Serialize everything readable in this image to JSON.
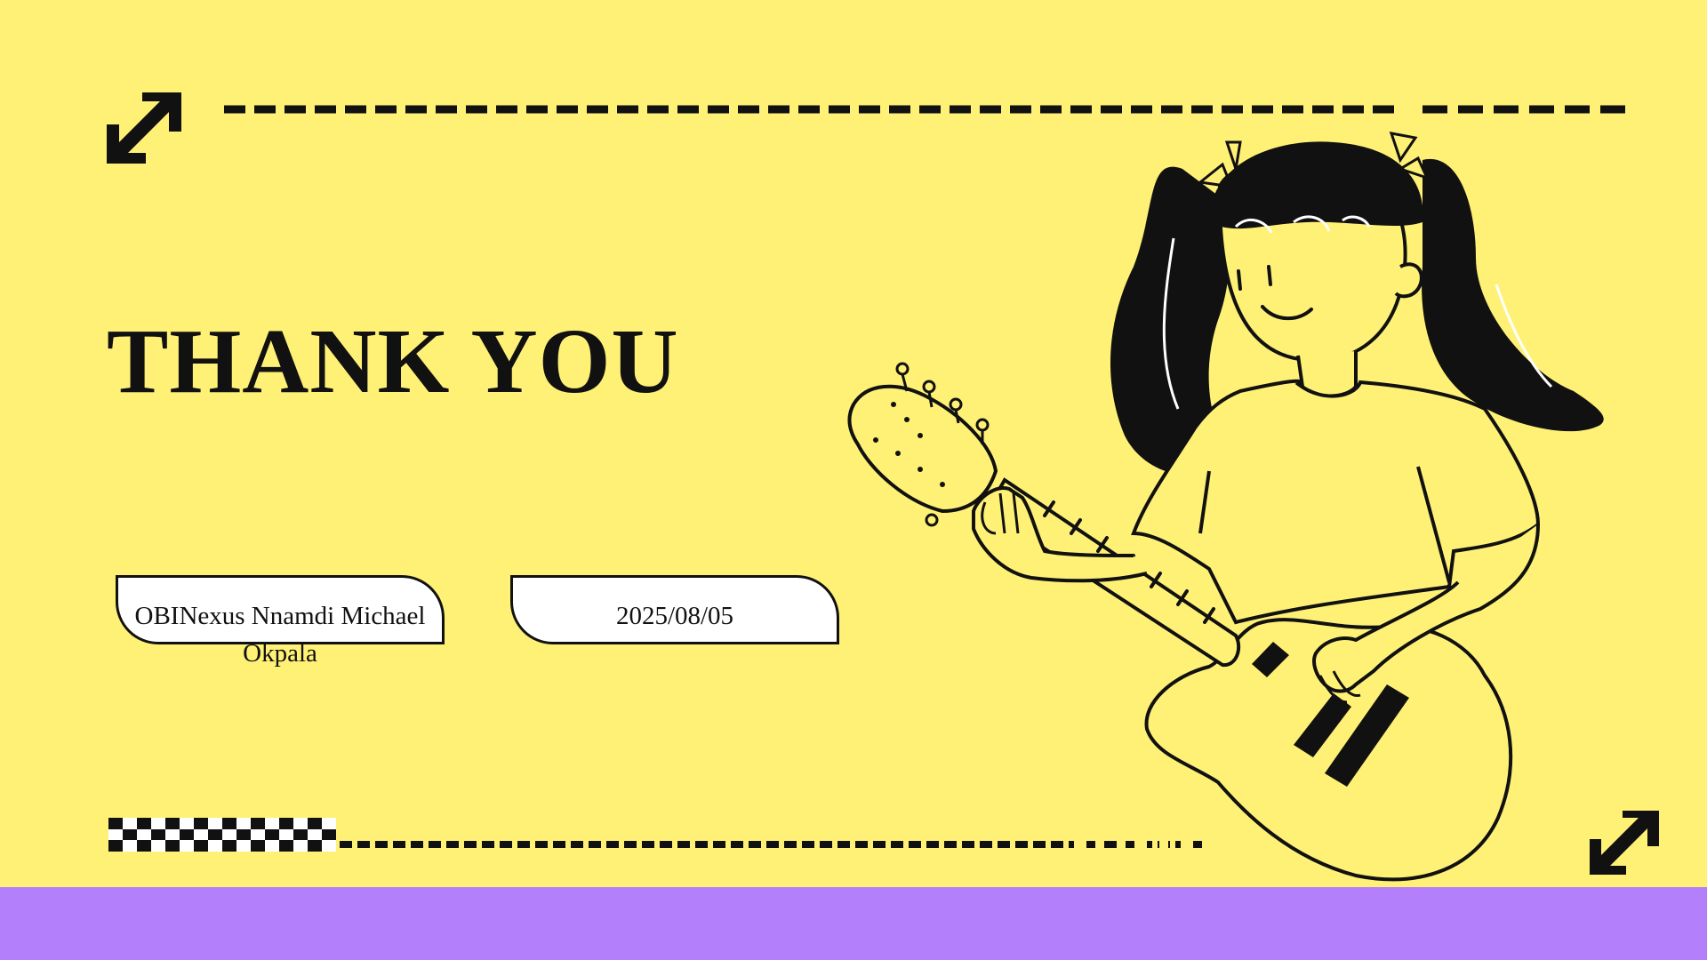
{
  "slide": {
    "title": "THANK YOU",
    "author_label": "OBINexus Nnamdi Michael Okpala",
    "date_label": "2025/08/05"
  },
  "icons": {
    "top_left": "diagonal-arrow-icon",
    "bottom_right": "diagonal-arrow-icon",
    "illustration": "girl-playing-guitar-illustration"
  },
  "colors": {
    "background": "#fff176",
    "bottom_bar": "#b47ffa",
    "ink": "#111111",
    "pill_fill": "#ffffff"
  }
}
